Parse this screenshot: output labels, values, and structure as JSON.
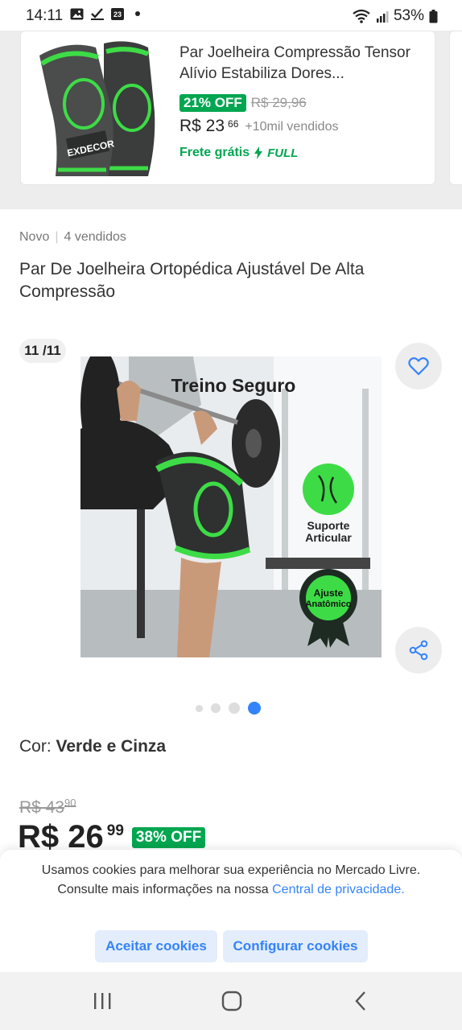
{
  "status_bar": {
    "time": "14:11",
    "calendar_day": "23",
    "battery": "53%"
  },
  "related_card": {
    "brand": "EXDECOR",
    "title": "Par Joelheira Compressão Tensor Alívio Estabiliza Dores...",
    "discount": "21% OFF",
    "old_price": "R$ 29,96",
    "price": "R$ 23",
    "price_cents": "66",
    "sold": "+10mil vendidos",
    "shipping": "Frete grátis",
    "shipping_tag": "FULL"
  },
  "product": {
    "condition": "Novo",
    "sold_count": "4 vendidos",
    "title": "Par De Joelheira Ortopédica Ajustável De Alta Compressão",
    "image_counter": "11 /11",
    "image_text": {
      "headline": "Treino Seguro",
      "badge1_line1": "Suporte",
      "badge1_line2": "Articular",
      "badge2_line1": "Ajuste",
      "badge2_line2": "Anatômico"
    },
    "gallery_dots_total": 4,
    "gallery_dots_active": 4,
    "color_label": "Cor:",
    "color_value": "Verde e Cinza",
    "old_price": "R$ 43",
    "old_price_cents": "90",
    "price": "R$ 26",
    "price_cents": "99",
    "discount": "38% OFF"
  },
  "cookie_banner": {
    "message": "Usamos cookies para melhorar sua experiência no Mercado Livre. Consulte mais informações na nossa ",
    "link": "Central de privacidade.",
    "accept": "Aceitar cookies",
    "configure": "Configurar cookies"
  },
  "colors": {
    "accent_blue": "#3483fa",
    "green": "#00a650",
    "product_green": "#3ddc46"
  },
  "icons": [
    "photo-icon",
    "check-icon",
    "calendar-icon",
    "wifi-icon",
    "signal-icon",
    "battery-icon",
    "heart-icon",
    "share-icon",
    "bolt-icon",
    "recents-icon",
    "home-icon",
    "back-icon"
  ]
}
